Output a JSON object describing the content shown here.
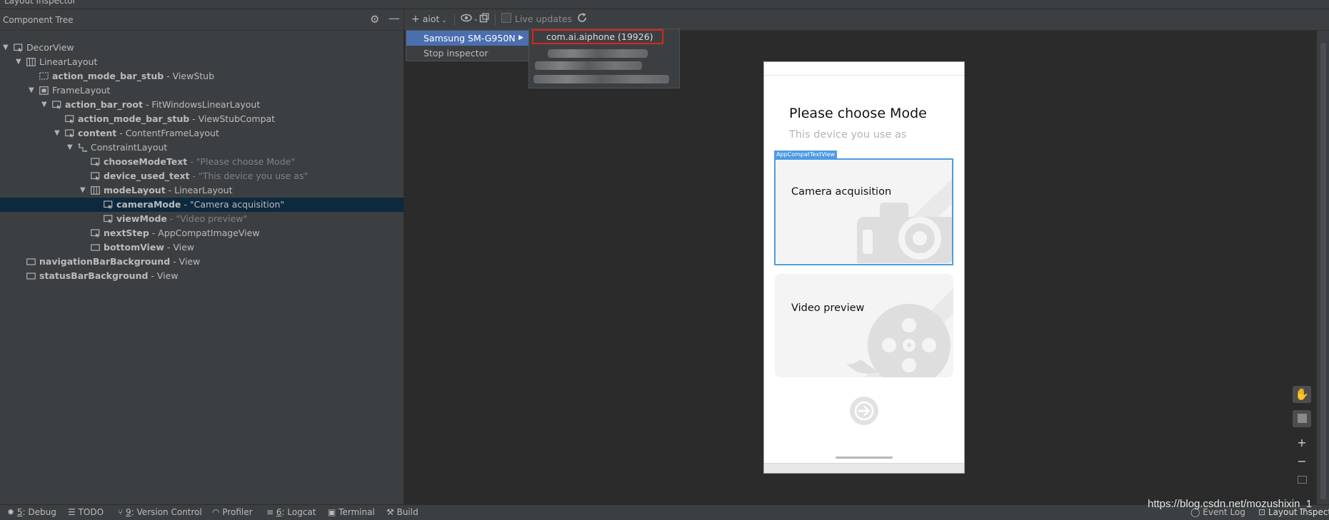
{
  "window": {
    "title": "Layout Inspector"
  },
  "tree_panel": {
    "title": "Component Tree",
    "nodes": [
      {
        "id": "DecorView",
        "type": "",
        "text": ""
      },
      {
        "id": "LinearLayout",
        "type": "",
        "text": ""
      },
      {
        "id": "action_mode_bar_stub",
        "type": " - ViewStub",
        "text": ""
      },
      {
        "id": "FrameLayout",
        "type": "",
        "text": ""
      },
      {
        "id": "action_bar_root",
        "type": " - FitWindowsLinearLayout",
        "text": ""
      },
      {
        "id": "action_mode_bar_stub",
        "type": " - ViewStubCompat",
        "text": ""
      },
      {
        "id": "content",
        "type": " - ContentFrameLayout",
        "text": ""
      },
      {
        "id": "ConstraintLayout",
        "type": "",
        "text": ""
      },
      {
        "id": "chooseModeText",
        "type": "",
        "text": " - \"Please choose Mode\""
      },
      {
        "id": "device_used_text",
        "type": "",
        "text": " - \"This device you use as\""
      },
      {
        "id": "modeLayout",
        "type": " - LinearLayout",
        "text": ""
      },
      {
        "id": "cameraMode",
        "type": "",
        "text": " - \"Camera acquisition\""
      },
      {
        "id": "viewMode",
        "type": "",
        "text": " - \"Video preview\""
      },
      {
        "id": "nextStep",
        "type": " - AppCompatImageView",
        "text": ""
      },
      {
        "id": "bottomView",
        "type": " - View",
        "text": ""
      },
      {
        "id": "navigationBarBackground",
        "type": " - View",
        "text": ""
      },
      {
        "id": "statusBarBackground",
        "type": " - View",
        "text": ""
      }
    ]
  },
  "toolbar": {
    "process_button": "aiot",
    "live_updates_label": "Live updates"
  },
  "device_menu": {
    "items": [
      {
        "label": "Samsung SM-G950N"
      },
      {
        "label": "Stop inspector"
      }
    ],
    "process_item": "com.ai.aiphone (19926)"
  },
  "phone": {
    "title": "Please choose Mode",
    "subtitle": "This device you use as",
    "selected_view_tag": "AppCompatTextView",
    "card_camera": "Camera acquisition",
    "card_video": "Video preview"
  },
  "bottom_bar": {
    "debug_num": "5",
    "debug_label": ": Debug",
    "todo_label": "TODO",
    "vcs_num": "9",
    "vcs_label": ": Version Control",
    "profiler_label": "Profiler",
    "logcat_num": "6",
    "logcat_label": ": Logcat",
    "terminal_label": "Terminal",
    "build_label": "Build",
    "event_log_label": "Event Log",
    "layout_inspector_label": "Layout Inspector"
  },
  "watermark": "https://blog.csdn.net/mozushixin_1",
  "colors": {
    "selection": "#0d293e",
    "menu_highlight": "#4b6eaf",
    "red_box": "#e0231c",
    "view_outline": "#4d9be5"
  }
}
